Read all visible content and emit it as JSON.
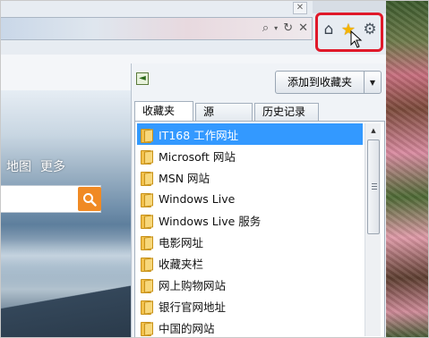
{
  "toolbar": {
    "address_controls": [
      "search-icon",
      "dropdown-arrow-icon",
      "refresh-icon",
      "close-icon"
    ],
    "icons": [
      "home-icon",
      "star-icon",
      "gear-icon"
    ],
    "highlight_color": "#e0192a"
  },
  "site": {
    "links": [
      "地图",
      "更多"
    ],
    "search_button_color": "#f08a24"
  },
  "favorites": {
    "add_button_label": "添加到收藏夹",
    "tabs": [
      {
        "label": "收藏夹",
        "active": true
      },
      {
        "label": "源",
        "active": false
      },
      {
        "label": "历史记录",
        "active": false
      }
    ],
    "items": [
      {
        "label": "IT168 工作网址",
        "selected": true
      },
      {
        "label": "Microsoft 网站",
        "selected": false
      },
      {
        "label": "MSN 网站",
        "selected": false
      },
      {
        "label": "Windows Live",
        "selected": false
      },
      {
        "label": "Windows Live 服务",
        "selected": false
      },
      {
        "label": "电影网址",
        "selected": false
      },
      {
        "label": "收藏夹栏",
        "selected": false
      },
      {
        "label": "网上购物网站",
        "selected": false
      },
      {
        "label": "银行官网地址",
        "selected": false
      },
      {
        "label": "中国的网站",
        "selected": false
      }
    ],
    "selection_color": "#3399ff"
  }
}
